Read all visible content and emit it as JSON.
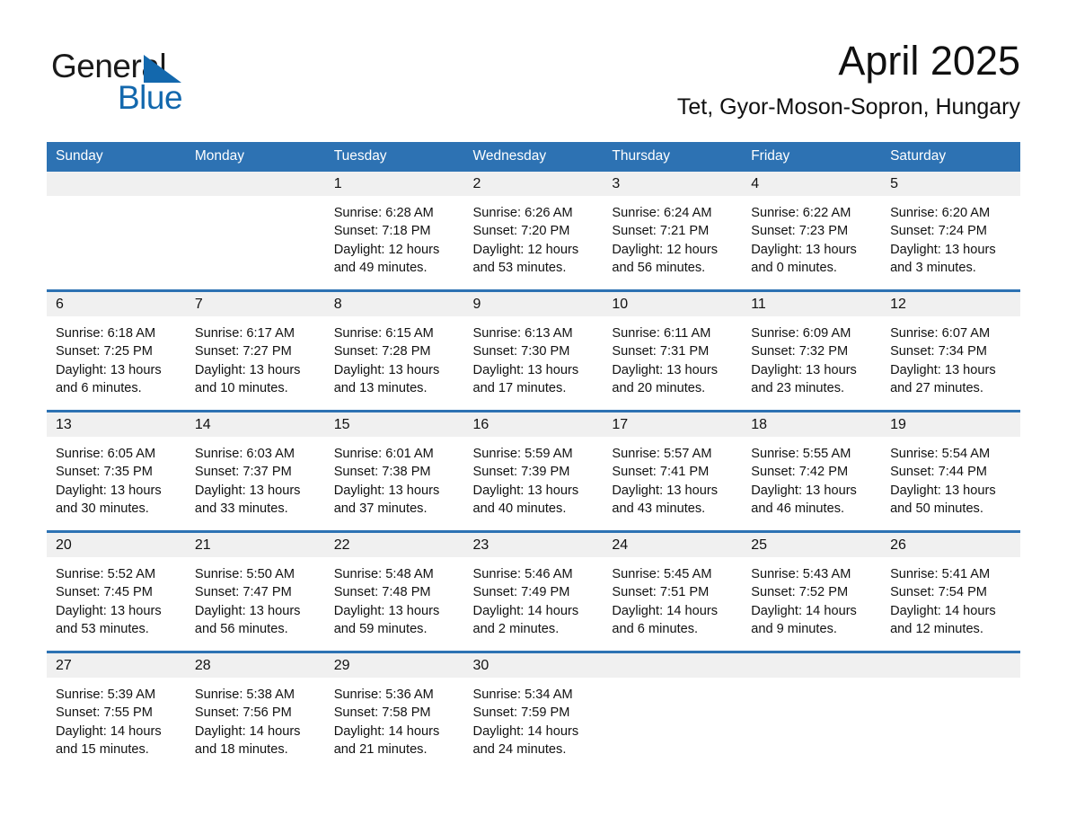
{
  "brand": {
    "name_part1": "General",
    "name_part2": "Blue",
    "triangle_color": "#1368ad",
    "logo_icon": "triangle-icon"
  },
  "header": {
    "title": "April 2025",
    "subtitle": "Tet, Gyor-Moson-Sopron, Hungary"
  },
  "colors": {
    "header_blue": "#2d72b3",
    "daynum_band": "#f0f0f0",
    "brand_blue": "#1368ad",
    "text": "#111111"
  },
  "weekday_headers": [
    "Sunday",
    "Monday",
    "Tuesday",
    "Wednesday",
    "Thursday",
    "Friday",
    "Saturday"
  ],
  "weeks": [
    [
      {
        "day": "",
        "sunrise": "",
        "sunset": "",
        "daylight_line1": "",
        "daylight_line2": ""
      },
      {
        "day": "",
        "sunrise": "",
        "sunset": "",
        "daylight_line1": "",
        "daylight_line2": ""
      },
      {
        "day": "1",
        "sunrise": "Sunrise: 6:28 AM",
        "sunset": "Sunset: 7:18 PM",
        "daylight_line1": "Daylight: 12 hours",
        "daylight_line2": "and 49 minutes."
      },
      {
        "day": "2",
        "sunrise": "Sunrise: 6:26 AM",
        "sunset": "Sunset: 7:20 PM",
        "daylight_line1": "Daylight: 12 hours",
        "daylight_line2": "and 53 minutes."
      },
      {
        "day": "3",
        "sunrise": "Sunrise: 6:24 AM",
        "sunset": "Sunset: 7:21 PM",
        "daylight_line1": "Daylight: 12 hours",
        "daylight_line2": "and 56 minutes."
      },
      {
        "day": "4",
        "sunrise": "Sunrise: 6:22 AM",
        "sunset": "Sunset: 7:23 PM",
        "daylight_line1": "Daylight: 13 hours",
        "daylight_line2": "and 0 minutes."
      },
      {
        "day": "5",
        "sunrise": "Sunrise: 6:20 AM",
        "sunset": "Sunset: 7:24 PM",
        "daylight_line1": "Daylight: 13 hours",
        "daylight_line2": "and 3 minutes."
      }
    ],
    [
      {
        "day": "6",
        "sunrise": "Sunrise: 6:18 AM",
        "sunset": "Sunset: 7:25 PM",
        "daylight_line1": "Daylight: 13 hours",
        "daylight_line2": "and 6 minutes."
      },
      {
        "day": "7",
        "sunrise": "Sunrise: 6:17 AM",
        "sunset": "Sunset: 7:27 PM",
        "daylight_line1": "Daylight: 13 hours",
        "daylight_line2": "and 10 minutes."
      },
      {
        "day": "8",
        "sunrise": "Sunrise: 6:15 AM",
        "sunset": "Sunset: 7:28 PM",
        "daylight_line1": "Daylight: 13 hours",
        "daylight_line2": "and 13 minutes."
      },
      {
        "day": "9",
        "sunrise": "Sunrise: 6:13 AM",
        "sunset": "Sunset: 7:30 PM",
        "daylight_line1": "Daylight: 13 hours",
        "daylight_line2": "and 17 minutes."
      },
      {
        "day": "10",
        "sunrise": "Sunrise: 6:11 AM",
        "sunset": "Sunset: 7:31 PM",
        "daylight_line1": "Daylight: 13 hours",
        "daylight_line2": "and 20 minutes."
      },
      {
        "day": "11",
        "sunrise": "Sunrise: 6:09 AM",
        "sunset": "Sunset: 7:32 PM",
        "daylight_line1": "Daylight: 13 hours",
        "daylight_line2": "and 23 minutes."
      },
      {
        "day": "12",
        "sunrise": "Sunrise: 6:07 AM",
        "sunset": "Sunset: 7:34 PM",
        "daylight_line1": "Daylight: 13 hours",
        "daylight_line2": "and 27 minutes."
      }
    ],
    [
      {
        "day": "13",
        "sunrise": "Sunrise: 6:05 AM",
        "sunset": "Sunset: 7:35 PM",
        "daylight_line1": "Daylight: 13 hours",
        "daylight_line2": "and 30 minutes."
      },
      {
        "day": "14",
        "sunrise": "Sunrise: 6:03 AM",
        "sunset": "Sunset: 7:37 PM",
        "daylight_line1": "Daylight: 13 hours",
        "daylight_line2": "and 33 minutes."
      },
      {
        "day": "15",
        "sunrise": "Sunrise: 6:01 AM",
        "sunset": "Sunset: 7:38 PM",
        "daylight_line1": "Daylight: 13 hours",
        "daylight_line2": "and 37 minutes."
      },
      {
        "day": "16",
        "sunrise": "Sunrise: 5:59 AM",
        "sunset": "Sunset: 7:39 PM",
        "daylight_line1": "Daylight: 13 hours",
        "daylight_line2": "and 40 minutes."
      },
      {
        "day": "17",
        "sunrise": "Sunrise: 5:57 AM",
        "sunset": "Sunset: 7:41 PM",
        "daylight_line1": "Daylight: 13 hours",
        "daylight_line2": "and 43 minutes."
      },
      {
        "day": "18",
        "sunrise": "Sunrise: 5:55 AM",
        "sunset": "Sunset: 7:42 PM",
        "daylight_line1": "Daylight: 13 hours",
        "daylight_line2": "and 46 minutes."
      },
      {
        "day": "19",
        "sunrise": "Sunrise: 5:54 AM",
        "sunset": "Sunset: 7:44 PM",
        "daylight_line1": "Daylight: 13 hours",
        "daylight_line2": "and 50 minutes."
      }
    ],
    [
      {
        "day": "20",
        "sunrise": "Sunrise: 5:52 AM",
        "sunset": "Sunset: 7:45 PM",
        "daylight_line1": "Daylight: 13 hours",
        "daylight_line2": "and 53 minutes."
      },
      {
        "day": "21",
        "sunrise": "Sunrise: 5:50 AM",
        "sunset": "Sunset: 7:47 PM",
        "daylight_line1": "Daylight: 13 hours",
        "daylight_line2": "and 56 minutes."
      },
      {
        "day": "22",
        "sunrise": "Sunrise: 5:48 AM",
        "sunset": "Sunset: 7:48 PM",
        "daylight_line1": "Daylight: 13 hours",
        "daylight_line2": "and 59 minutes."
      },
      {
        "day": "23",
        "sunrise": "Sunrise: 5:46 AM",
        "sunset": "Sunset: 7:49 PM",
        "daylight_line1": "Daylight: 14 hours",
        "daylight_line2": "and 2 minutes."
      },
      {
        "day": "24",
        "sunrise": "Sunrise: 5:45 AM",
        "sunset": "Sunset: 7:51 PM",
        "daylight_line1": "Daylight: 14 hours",
        "daylight_line2": "and 6 minutes."
      },
      {
        "day": "25",
        "sunrise": "Sunrise: 5:43 AM",
        "sunset": "Sunset: 7:52 PM",
        "daylight_line1": "Daylight: 14 hours",
        "daylight_line2": "and 9 minutes."
      },
      {
        "day": "26",
        "sunrise": "Sunrise: 5:41 AM",
        "sunset": "Sunset: 7:54 PM",
        "daylight_line1": "Daylight: 14 hours",
        "daylight_line2": "and 12 minutes."
      }
    ],
    [
      {
        "day": "27",
        "sunrise": "Sunrise: 5:39 AM",
        "sunset": "Sunset: 7:55 PM",
        "daylight_line1": "Daylight: 14 hours",
        "daylight_line2": "and 15 minutes."
      },
      {
        "day": "28",
        "sunrise": "Sunrise: 5:38 AM",
        "sunset": "Sunset: 7:56 PM",
        "daylight_line1": "Daylight: 14 hours",
        "daylight_line2": "and 18 minutes."
      },
      {
        "day": "29",
        "sunrise": "Sunrise: 5:36 AM",
        "sunset": "Sunset: 7:58 PM",
        "daylight_line1": "Daylight: 14 hours",
        "daylight_line2": "and 21 minutes."
      },
      {
        "day": "30",
        "sunrise": "Sunrise: 5:34 AM",
        "sunset": "Sunset: 7:59 PM",
        "daylight_line1": "Daylight: 14 hours",
        "daylight_line2": "and 24 minutes."
      },
      {
        "day": "",
        "sunrise": "",
        "sunset": "",
        "daylight_line1": "",
        "daylight_line2": ""
      },
      {
        "day": "",
        "sunrise": "",
        "sunset": "",
        "daylight_line1": "",
        "daylight_line2": ""
      },
      {
        "day": "",
        "sunrise": "",
        "sunset": "",
        "daylight_line1": "",
        "daylight_line2": ""
      }
    ]
  ]
}
